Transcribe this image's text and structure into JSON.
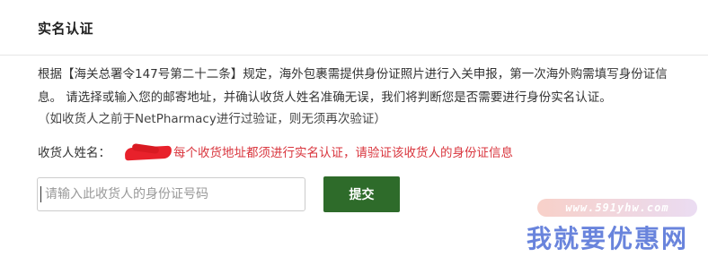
{
  "header": {
    "title": "实名认证"
  },
  "notice": {
    "line1": "根据【海关总署令147号第二十二条】规定，海外包裹需提供身份证照片进行入关申报，第一次海外购需填写身份证信",
    "line2": "息。 请选择或输入您的邮寄地址，并确认收货人姓名准确无误，我们将判断您是否需要进行身份实名认证。",
    "note": "（如收货人之前于NetPharmacy进行过验证，则无须再次验证）"
  },
  "recipient": {
    "label": "收货人姓名：",
    "name_redacted": "",
    "hint": "每个收货地址都须进行实名认证，请验证该收货人的身份证信息"
  },
  "id_form": {
    "input_value": "",
    "input_placeholder": "请输入此收货人的身份证号码",
    "submit_label": "提交"
  },
  "watermark": {
    "url": "www.591yhw.com",
    "text": "我就要优惠网"
  },
  "colors": {
    "submit_bg": "#2e6b2a",
    "hint_red": "#d9363e",
    "redaction_red": "#e8212b",
    "watermark_blue": "#4f6fd6"
  }
}
